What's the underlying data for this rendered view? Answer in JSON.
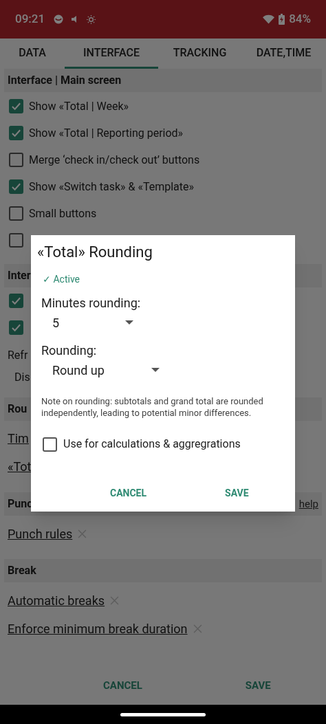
{
  "status_bar": {
    "time": "09:21",
    "battery": "84%"
  },
  "tabs": [
    {
      "label": "DATA",
      "selected": false
    },
    {
      "label": "INTERFACE",
      "selected": true
    },
    {
      "label": "TRACKING",
      "selected": false
    },
    {
      "label": "DATE,TIME",
      "selected": false
    }
  ],
  "sections": [
    {
      "title": "Interface | Main screen",
      "items": [
        {
          "kind": "checkbox",
          "label": "Show «Total | Week»",
          "checked": true
        },
        {
          "kind": "checkbox",
          "label": "Show «Total | Reporting period»",
          "checked": true
        },
        {
          "kind": "checkbox",
          "label": "Merge ‘check in/check out’ buttons",
          "checked": false
        },
        {
          "kind": "checkbox",
          "label": "Show «Switch task» & «Template»",
          "checked": true
        },
        {
          "kind": "checkbox",
          "label": "Small buttons",
          "checked": false
        },
        {
          "kind": "checkbox",
          "checked": false
        }
      ]
    },
    {
      "title": "Inter",
      "items": [
        {
          "kind": "checkbox",
          "checked": true
        },
        {
          "kind": "checkbox",
          "checked": true
        },
        {
          "kind": "text",
          "label": "Refr"
        },
        {
          "kind": "subtext",
          "label": "Dis"
        }
      ]
    },
    {
      "title": "Rou",
      "items": [
        {
          "kind": "link",
          "label": "Tim"
        },
        {
          "kind": "link",
          "label": "«Tot"
        }
      ]
    },
    {
      "title": "Punc",
      "help": "help",
      "items": [
        {
          "kind": "link",
          "label": "Punch rules",
          "removable": true
        }
      ]
    },
    {
      "title": "Break",
      "items": [
        {
          "kind": "link",
          "label": "Automatic breaks",
          "removable": true
        },
        {
          "kind": "link",
          "label": "Enforce minimum break duration",
          "removable": true
        }
      ]
    }
  ],
  "footer_buttons": [
    "CANCEL",
    "SAVE"
  ],
  "dialog": {
    "title": "«Total» Rounding",
    "status": "✓ Active",
    "fields": [
      {
        "label": "Minutes rounding:",
        "value": "5"
      },
      {
        "label": "Rounding:",
        "value": "Round up"
      }
    ],
    "note": "Note on rounding: subtotals and grand total are rounded independently, leading to potential minor differences.",
    "checkbox": {
      "label": "Use for calculations & aggregrations",
      "checked": false
    },
    "buttons": [
      "CANCEL",
      "SAVE"
    ]
  }
}
